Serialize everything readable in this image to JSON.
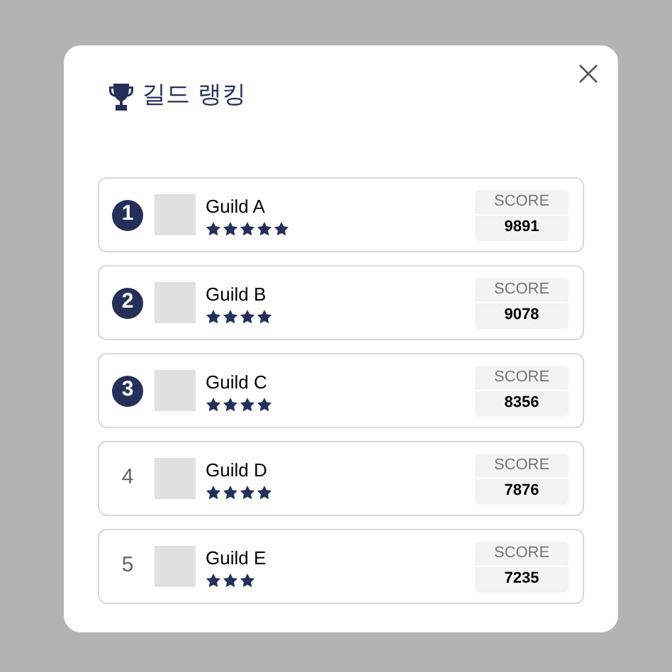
{
  "dialog": {
    "title": "길드 랭킹"
  },
  "guilds": [
    {
      "rank": "1",
      "kind": "badge",
      "name": "Guild A",
      "stars": 5,
      "score_label": "SCORE",
      "score": "9891"
    },
    {
      "rank": "2",
      "kind": "badge",
      "name": "Guild B",
      "stars": 4,
      "score_label": "SCORE",
      "score": "9078"
    },
    {
      "rank": "3",
      "kind": "badge",
      "name": "Guild C",
      "stars": 4,
      "score_label": "SCORE",
      "score": "8356"
    },
    {
      "rank": "4",
      "kind": "plain",
      "name": "Guild D",
      "stars": 4,
      "score_label": "SCORE",
      "score": "7876"
    },
    {
      "rank": "5",
      "kind": "plain",
      "name": "Guild E",
      "stars": 3,
      "score_label": "SCORE",
      "score": "7235"
    }
  ]
}
